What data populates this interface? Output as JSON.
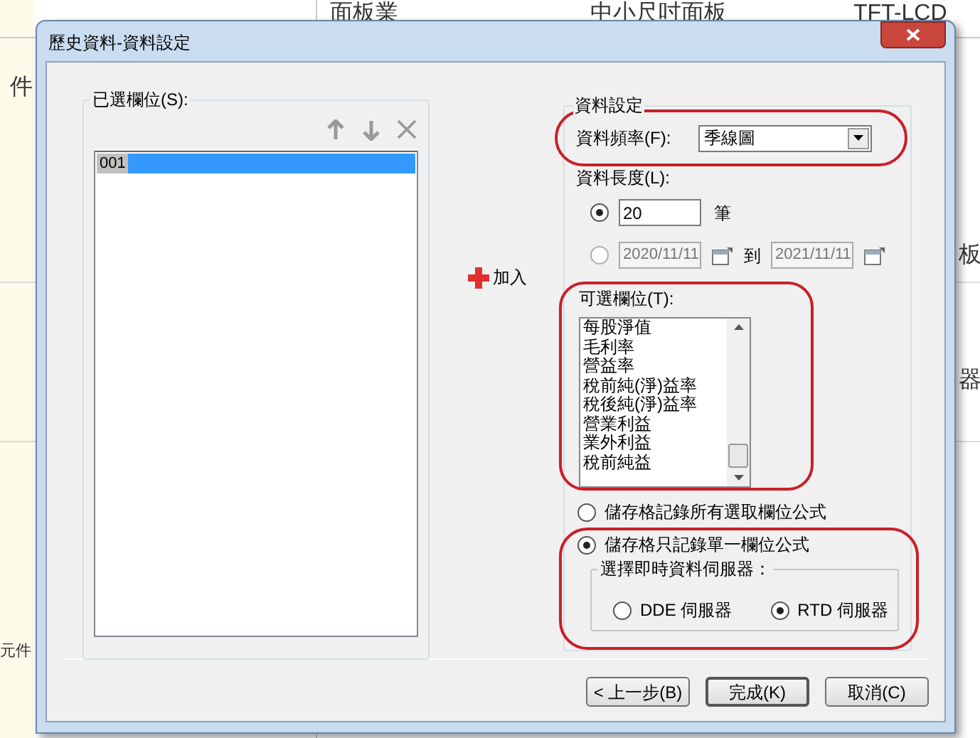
{
  "background_sheet": {
    "header_cells": [
      "面板業",
      "中小尺吋面板",
      "TFT-LCD"
    ],
    "left_cells": [
      "件",
      "元件"
    ],
    "right_cells": [
      "板",
      "器"
    ]
  },
  "dialog": {
    "title": "歷史資料-資料設定"
  },
  "selected_fields": {
    "label": "已選欄位(S):",
    "items": [
      {
        "text": "001",
        "selected": true
      }
    ]
  },
  "add_button": {
    "label": "加入"
  },
  "data_settings": {
    "title": "資料設定",
    "frequency": {
      "label": "資料頻率(F):",
      "value": "季線圖"
    },
    "length_label": "資料長度(L):",
    "length_options": [
      {
        "kind": "count",
        "selected": true,
        "value": "20",
        "unit": "筆"
      },
      {
        "kind": "range",
        "selected": false,
        "from": "2020/11/11",
        "to_label": "到",
        "to": "2021/11/11"
      }
    ],
    "available_fields": {
      "label": "可選欄位(T):",
      "items": [
        "每股淨值",
        "毛利率",
        "營益率",
        "稅前純(淨)益率",
        "稅後純(淨)益率",
        "營業利益",
        "業外利益",
        "稅前純益"
      ]
    }
  },
  "formula_options": [
    {
      "label": "儲存格記錄所有選取欄位公式",
      "selected": false
    },
    {
      "label": "儲存格只記錄單一欄位公式",
      "selected": true
    }
  ],
  "server": {
    "label": "選擇即時資料伺服器：",
    "options": [
      {
        "label": "DDE 伺服器",
        "selected": false
      },
      {
        "label": "RTD 伺服器",
        "selected": true
      }
    ]
  },
  "buttons": [
    {
      "label": "< 上一步(B)",
      "default": false
    },
    {
      "label": "完成(K)",
      "default": true
    },
    {
      "label": "取消(C)",
      "default": false
    }
  ]
}
